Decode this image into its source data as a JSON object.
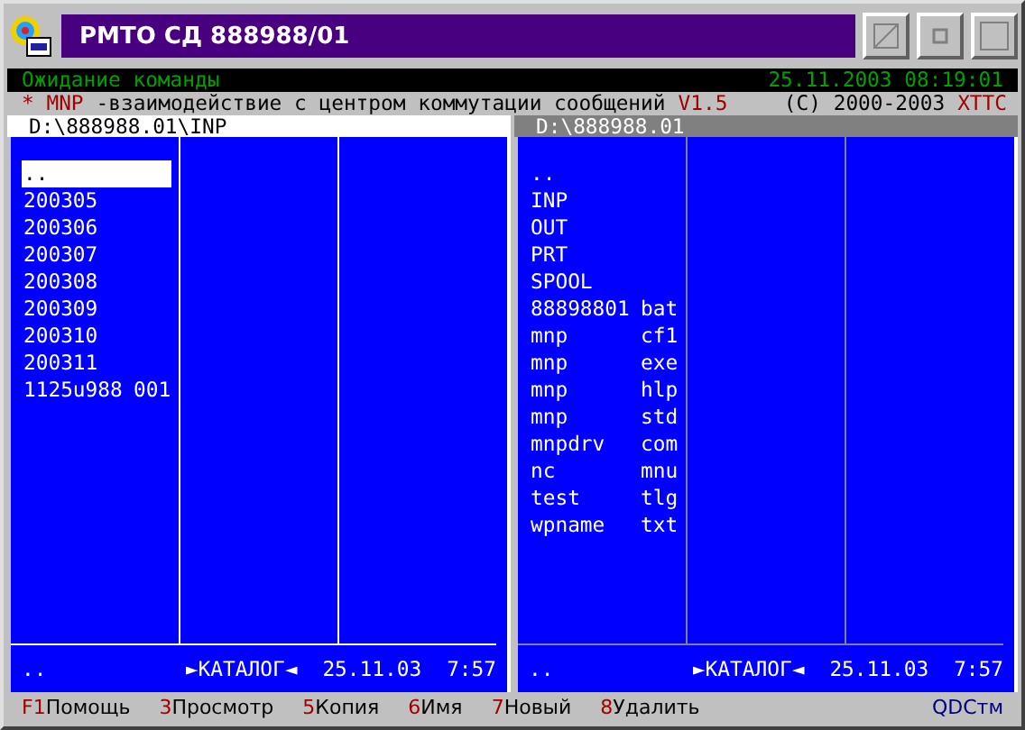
{
  "window": {
    "title": "РМТО СД 888988/01"
  },
  "status_bar": {
    "message": "Ожидание команды",
    "datetime": "25.11.2003 08:19:01"
  },
  "info_line": [
    {
      "text": "* MNP",
      "kind": "accent"
    },
    {
      "text": "-взаимодействие с центром коммутации сообщений",
      "kind": "plain"
    },
    {
      "text": "V1.5",
      "kind": "accent"
    },
    {
      "text": "(C) 2000-2003",
      "kind": "plain"
    },
    {
      "text": "XTTC",
      "kind": "accent"
    }
  ],
  "panels": [
    {
      "path": "D:\\888988.01\\INP",
      "active": true,
      "files": [
        {
          "name": "..",
          "selected": true
        },
        {
          "name": "200305",
          "selected": false
        },
        {
          "name": "200306",
          "selected": false
        },
        {
          "name": "200307",
          "selected": false
        },
        {
          "name": "200308",
          "selected": false
        },
        {
          "name": "200309",
          "selected": false
        },
        {
          "name": "200310",
          "selected": false
        },
        {
          "name": "200311",
          "selected": false
        },
        {
          "name": "1125u988",
          "ext": "001",
          "selected": false
        }
      ],
      "footer": {
        "name": "..",
        "type": "►КАТАЛОГ◄",
        "date": "25.11.03",
        "time": "7:57"
      }
    },
    {
      "path": "D:\\888988.01",
      "active": false,
      "files": [
        {
          "name": "..",
          "selected": false
        },
        {
          "name": "INP",
          "selected": false
        },
        {
          "name": "OUT",
          "selected": false
        },
        {
          "name": "PRT",
          "selected": false
        },
        {
          "name": "SPOOL",
          "selected": false
        },
        {
          "name": "88898801",
          "ext": "bat",
          "selected": false
        },
        {
          "name": "mnp",
          "ext": "cf1",
          "selected": false
        },
        {
          "name": "mnp",
          "ext": "exe",
          "selected": false
        },
        {
          "name": "mnp",
          "ext": "hlp",
          "selected": false
        },
        {
          "name": "mnp",
          "ext": "std",
          "selected": false
        },
        {
          "name": "mnpdrv",
          "ext": "com",
          "selected": false
        },
        {
          "name": "nc",
          "ext": "mnu",
          "selected": false
        },
        {
          "name": "test",
          "ext": "tlg",
          "selected": false
        },
        {
          "name": "wpname",
          "ext": "txt",
          "selected": false
        }
      ],
      "footer": {
        "name": "..",
        "type": "►КАТАЛОГ◄",
        "date": "25.11.03",
        "time": "7:57"
      }
    }
  ],
  "function_keys": [
    {
      "key": "F1",
      "label": "Помощь"
    },
    {
      "key": "3",
      "label": "Просмотр"
    },
    {
      "key": "5",
      "label": "Копия"
    },
    {
      "key": "6",
      "label": "Имя"
    },
    {
      "key": "7",
      "label": "Новый"
    },
    {
      "key": "8",
      "label": "Удалить"
    }
  ],
  "brand": "QDCтм"
}
